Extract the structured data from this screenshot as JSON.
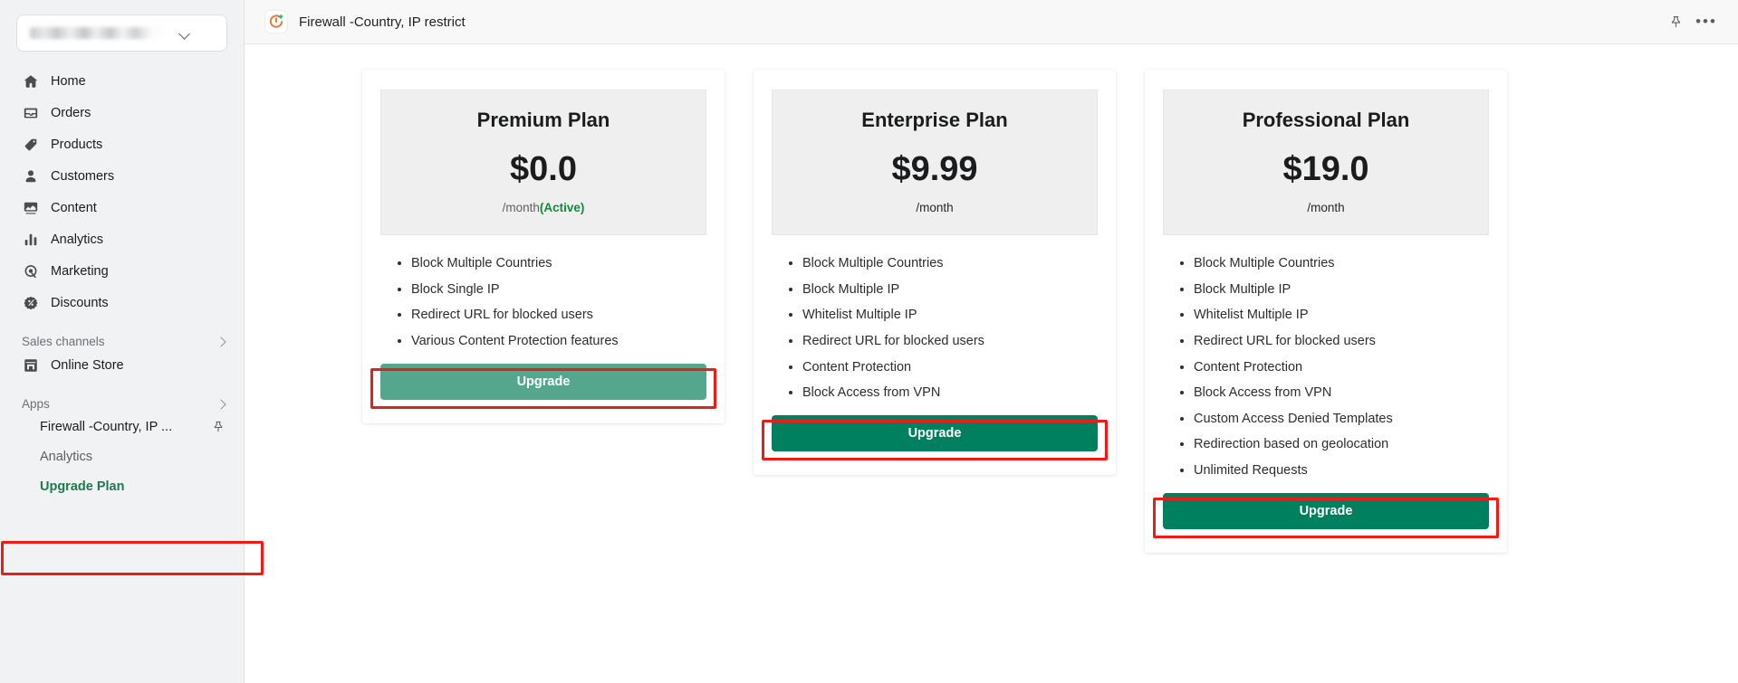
{
  "sidebar": {
    "store_switcher": {
      "name": "",
      "icon": "chevron-down-icon"
    },
    "nav_items": [
      {
        "label": "Home",
        "icon": "home-icon"
      },
      {
        "label": "Orders",
        "icon": "orders-icon"
      },
      {
        "label": "Products",
        "icon": "products-tag-icon"
      },
      {
        "label": "Customers",
        "icon": "customers-person-icon"
      },
      {
        "label": "Content",
        "icon": "content-image-icon"
      },
      {
        "label": "Analytics",
        "icon": "analytics-bars-icon"
      },
      {
        "label": "Marketing",
        "icon": "marketing-target-icon"
      },
      {
        "label": "Discounts",
        "icon": "discounts-badge-icon"
      }
    ],
    "sales_channels": {
      "label": "Sales channels",
      "icon": "chevron-right-icon"
    },
    "online_store": {
      "label": "Online Store",
      "icon": "storefront-icon"
    },
    "apps": {
      "label": "Apps",
      "icon": "chevron-right-icon"
    },
    "app_items": [
      {
        "label": "Firewall -Country, IP ...",
        "icon": "pin-icon"
      },
      {
        "label": "Analytics"
      },
      {
        "label": "Upgrade Plan"
      }
    ]
  },
  "topbar": {
    "app_icon": "firewall-app-icon",
    "title": "Firewall -Country, IP restrict",
    "pin_icon": "pin-icon",
    "more_icon": "more-horizontal-icon",
    "more_label": "•••"
  },
  "plans": [
    {
      "name": "Premium Plan",
      "price": "$0.0",
      "period": "/month",
      "status": "(Active)",
      "has_status": true,
      "period_dark": false,
      "features": [
        "Block Multiple Countries",
        "Block Single IP",
        "Redirect URL for blocked users",
        "Various Content Protection features"
      ],
      "button_label": "Upgrade",
      "button_style": "muted",
      "button_color": "#54a78d",
      "highlighted": true
    },
    {
      "name": "Enterprise Plan",
      "price": "$9.99",
      "period": "/month",
      "status": "",
      "has_status": false,
      "period_dark": true,
      "features": [
        "Block Multiple Countries",
        "Block Multiple IP",
        "Whitelist Multiple IP",
        "Redirect URL for blocked users",
        "Content Protection",
        "Block Access from VPN"
      ],
      "button_label": "Upgrade",
      "button_style": "solid",
      "button_color": "#00805f",
      "highlighted": true
    },
    {
      "name": "Professional Plan",
      "price": "$19.0",
      "period": "/month",
      "status": "",
      "has_status": false,
      "period_dark": true,
      "features": [
        "Block Multiple Countries",
        "Block Multiple IP",
        "Whitelist Multiple IP",
        "Redirect URL for blocked users",
        "Content Protection",
        "Block Access from VPN",
        "Custom Access Denied Templates",
        "Redirection based on geolocation",
        "Unlimited Requests"
      ],
      "button_label": "Upgrade",
      "button_style": "solid",
      "button_color": "#00805f",
      "highlighted": true
    }
  ],
  "colors": {
    "sidebar_bg": "#f1f2f4",
    "topbar_bg": "#f8f8f8",
    "card_head_bg": "#efefef",
    "accent_green": "#00805f",
    "muted_green": "#54a78d",
    "active_green": "#128a3b",
    "annotation_red": "#ef1b16",
    "upgrade_nav_green": "#1c7a51"
  }
}
